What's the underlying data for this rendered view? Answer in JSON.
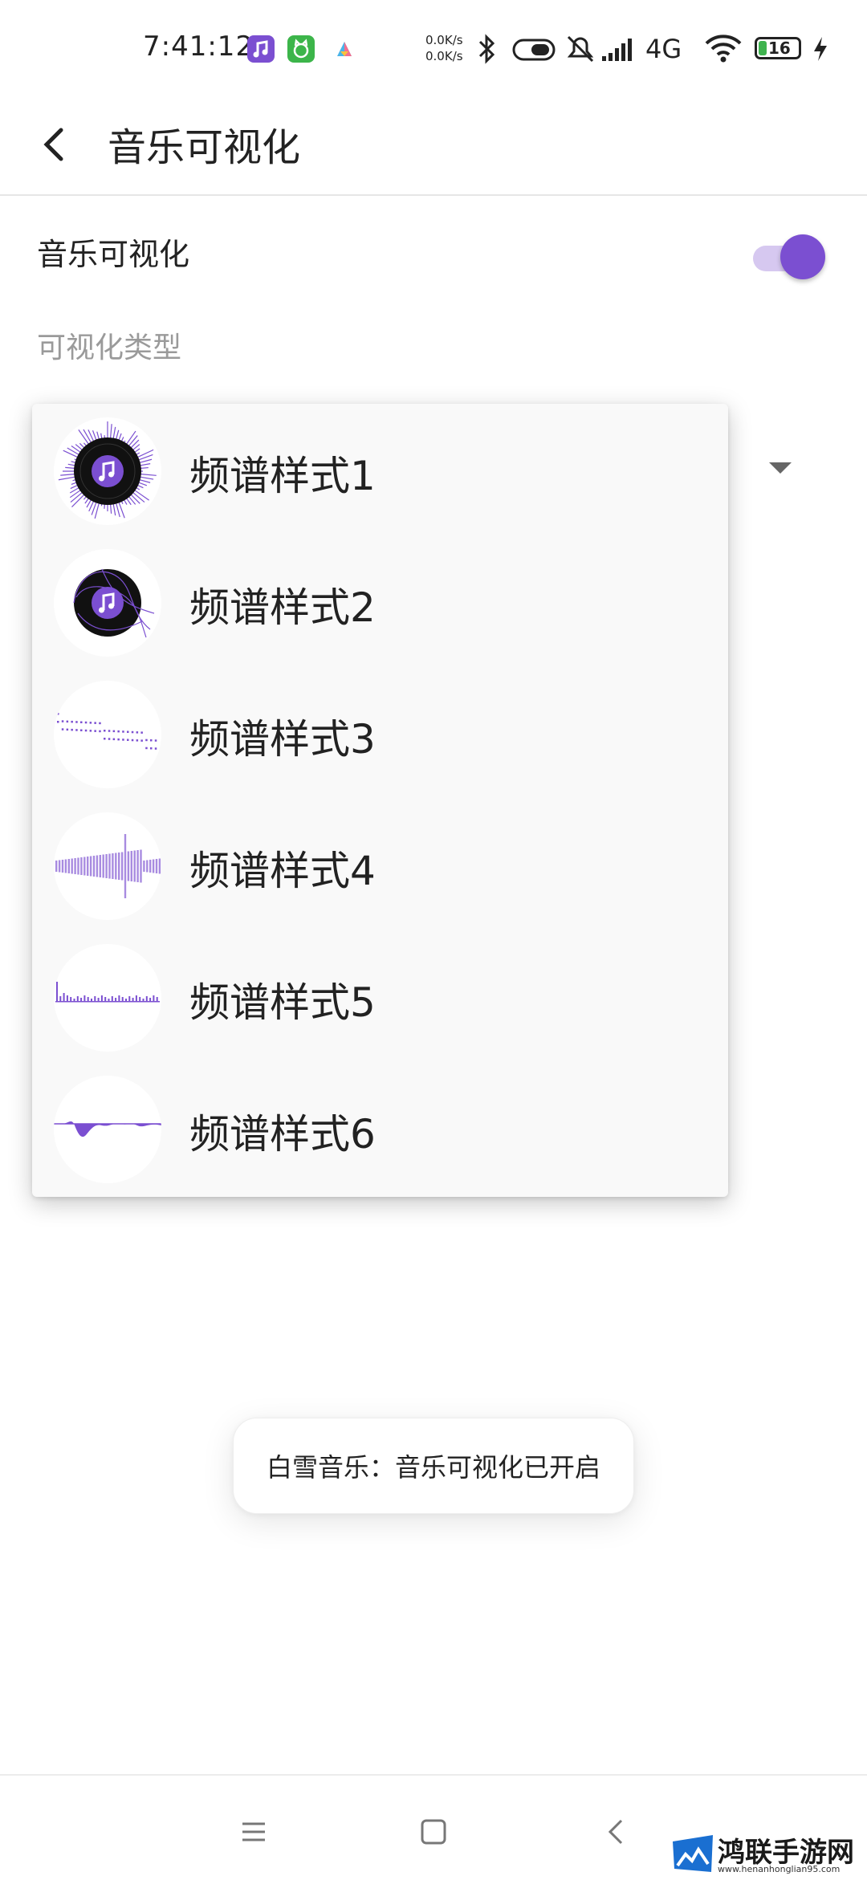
{
  "status_bar": {
    "time": "7:41:12",
    "net_up": "0.0K/s",
    "net_down": "0.0K/s",
    "network": "4G",
    "battery": "16",
    "icons": [
      "music-app-icon",
      "cat-app-icon",
      "triangle-app-icon",
      "bluetooth-icon",
      "toggle-status-icon",
      "mute-bell-icon",
      "signal-icon",
      "wifi-icon",
      "battery-icon",
      "charging-icon"
    ]
  },
  "appbar": {
    "title": "音乐可视化",
    "back_icon": "chevron-left-icon"
  },
  "settings": {
    "toggle_label": "音乐可视化",
    "toggle_on": true,
    "section_label": "可视化类型"
  },
  "menu": {
    "items": [
      {
        "label": "频谱样式1",
        "icon": "radial-spectrum-icon"
      },
      {
        "label": "频谱样式2",
        "icon": "wave-spectrum-icon"
      },
      {
        "label": "频谱样式3",
        "icon": "dots-spectrum-icon"
      },
      {
        "label": "频谱样式4",
        "icon": "bars-waveform-icon"
      },
      {
        "label": "频谱样式5",
        "icon": "baseline-bars-icon"
      },
      {
        "label": "频谱样式6",
        "icon": "filled-wave-icon"
      }
    ]
  },
  "toast": {
    "text": "白雪音乐：音乐可视化已开启"
  },
  "nav": {
    "icons": [
      "menu-icon",
      "home-square-icon",
      "back-chevron-icon"
    ]
  },
  "watermark": {
    "title": "鸿联手游网",
    "url": "www.henanhonglian95.com"
  },
  "colors": {
    "accent": "#7b4fd1",
    "accent_light": "#d6c8f0",
    "menu_bg": "#f9f9f9"
  }
}
